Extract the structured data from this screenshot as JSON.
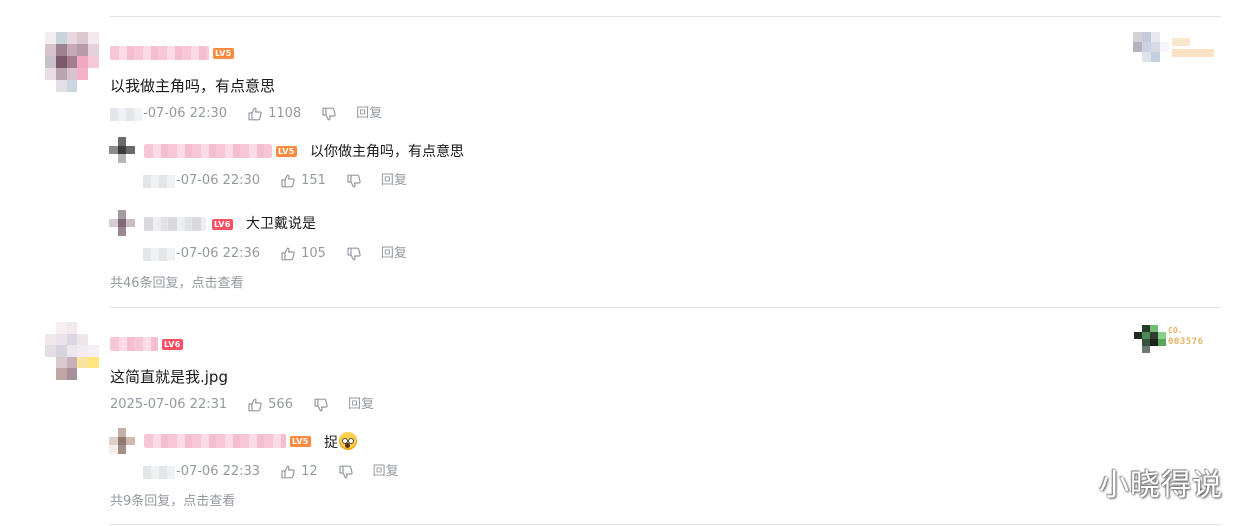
{
  "comments": [
    {
      "text": "以我做主角吗，有点意思",
      "level": "LV5",
      "date": "-07-06 22:30",
      "likes": "1108",
      "reply_label": "回复",
      "replies": [
        {
          "level": "LV5",
          "text": "以你做主角吗，有点意思",
          "date": "-07-06 22:30",
          "likes": "151",
          "reply_label": "回复"
        },
        {
          "level": "LV6",
          "text": "大卫戴说是",
          "date": "-07-06 22:36",
          "likes": "105",
          "reply_label": "回复"
        }
      ],
      "more_replies": "共46条回复，点击查看"
    },
    {
      "text": "这简直就是我.jpg",
      "level": "LV6",
      "date": "2025-07-06 22:31",
      "likes": "566",
      "reply_label": "回复",
      "badge": {
        "line1": "CO.",
        "line2": "003576"
      },
      "replies": [
        {
          "level": "LV5",
          "text": "捉",
          "date": "-07-06 22:33",
          "likes": "12",
          "reply_label": "回复"
        }
      ],
      "more_replies": "共9条回复，点击查看"
    }
  ],
  "watermark": "小晓得说",
  "icons": {
    "like": "thumb-up-icon",
    "dislike": "thumb-down-icon",
    "emoji": "scream-emoji-icon"
  },
  "colors": {
    "lv5": "#ff8a3d",
    "lv6": "#ff4f62",
    "meta": "#9499a0",
    "divider": "#e3e5e7"
  }
}
